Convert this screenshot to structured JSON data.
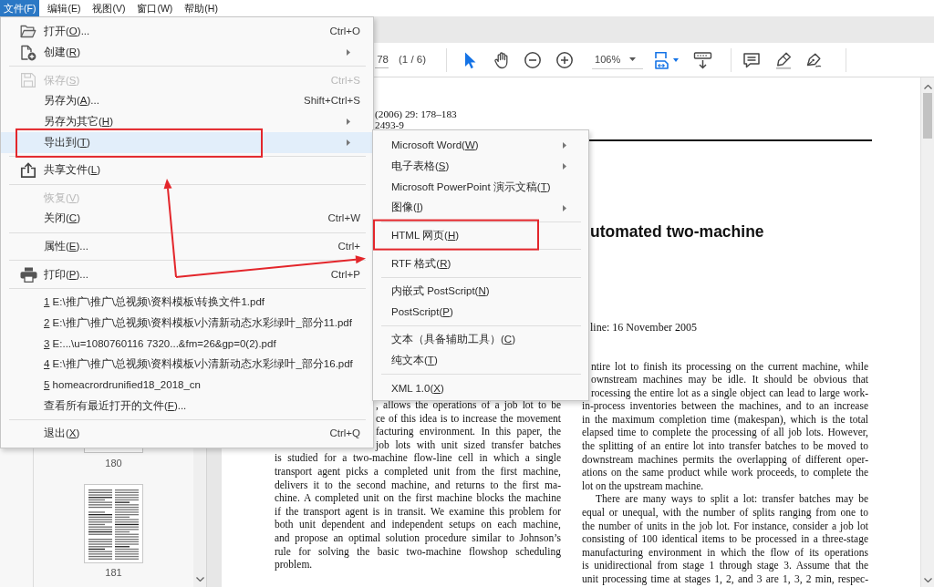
{
  "menu_bar": [
    {
      "label": "文件(F)",
      "selected": true
    },
    {
      "label": "编辑(E)",
      "selected": false
    },
    {
      "label": "视图(V)",
      "selected": false
    },
    {
      "label": "窗口(W)",
      "selected": false
    },
    {
      "label": "帮助(H)",
      "selected": false
    }
  ],
  "toolbar": {
    "page_field": {
      "value": "78"
    },
    "page_count": "(1 / 6)",
    "tools": [
      {
        "selected": true
      },
      {
        "selected": false
      }
    ],
    "zoom_field": {
      "value": "106%"
    },
    "fit_button": {
      "active": true
    }
  },
  "thumbnail_panel": {
    "pages": [
      {
        "kind": "cut",
        "label": "180"
      },
      {
        "kind": "full",
        "label": "181"
      }
    ]
  },
  "document": {
    "header_lines": [
      "(2006) 29: 178–183",
      "2493-9"
    ],
    "title": "utomated two-machine",
    "date_line": "line: 16 November 2005",
    "columns": [
      {
        "paragraphs": [
          {
            "kind": "cut",
            "lines": [
              ", allows the operations of a job lot to be",
              "ce of this idea is to increase the movement",
              "facturing environment. In this paper, the",
              "job lots with unit sized transfer batches"
            ]
          },
          {
            "kind": "full",
            "indent": false,
            "lines": [
              "is studied for a two-machine flow-line cell in which a single",
              "transport agent picks a completed unit from the first machine,",
              "delivers it to the second machine, and returns to the first ma-",
              "chine. A completed unit on the first machine blocks the machine",
              "if the transport agent is in transit. We examine this problem for",
              "both unit dependent and independent setups on each machine,",
              "and propose an optimal solution procedure similar to Johnson’s",
              "rule for solving the basic two-machine flowshop scheduling",
              "problem."
            ]
          }
        ]
      },
      {
        "paragraphs": [
          {
            "kind": "cut",
            "lines": [
              "ntire lot to finish its processing on the current machine, while",
              "ownstream machines may be idle. It should be obvious that",
              "rocessing the entire lot as a single object can lead to large work-"
            ]
          },
          {
            "kind": "full",
            "indent": false,
            "ends": true,
            "lines": [
              "in-process inventories between the machines, and to an increase",
              "in the maximum completion time (makespan), which is the total",
              "elapsed time to complete the processing of all job lots. However,",
              "the splitting of an entire lot into transfer batches to be moved to",
              "downstream machines permits the overlapping of different oper-",
              "ations on the same product while work proceeds, to complete the",
              "lot on the upstream machine."
            ]
          },
          {
            "kind": "full",
            "indent": true,
            "ends": false,
            "lines": [
              "There are many ways to split a lot: transfer batches may be",
              "equal or unequal, with the number of splits ranging from one to",
              "the number of units in the job lot. For instance, consider a job lot",
              "consisting of 100 identical items to be processed in a three-stage",
              "manufacturing environment in which the flow of its operations",
              "is unidirectional from stage 1 through stage 3. Assume that the",
              "unit processing time at stages 1, 2, and 3 are 1, 3, 2 min, respec-"
            ]
          }
        ]
      }
    ]
  },
  "file_menu": {
    "sections": [
      [
        {
          "before": "打开(",
          "access_key": "O",
          "after": ")...",
          "shortcut": "Ctrl+O",
          "has_submenu": false,
          "disabled": false,
          "highlighted": false,
          "marked": false
        },
        {
          "before": "创建(",
          "access_key": "R",
          "after": ")",
          "has_submenu": true,
          "disabled": false,
          "highlighted": false,
          "marked": false
        }
      ],
      [
        {
          "before": "保存(",
          "access_key": "S",
          "after": ")",
          "shortcut": "Ctrl+S",
          "has_submenu": false,
          "disabled": true,
          "highlighted": false,
          "marked": false
        },
        {
          "before": "另存为(",
          "access_key": "A",
          "after": ")...",
          "shortcut": "Shift+Ctrl+S",
          "has_submenu": false,
          "disabled": false,
          "highlighted": false,
          "marked": false
        },
        {
          "before": "另存为其它(",
          "access_key": "H",
          "after": ")",
          "has_submenu": true,
          "disabled": false,
          "highlighted": false,
          "marked": false
        },
        {
          "before": "导出到(",
          "access_key": "T",
          "after": ")",
          "has_submenu": true,
          "disabled": false,
          "highlighted": true,
          "marked": true
        }
      ],
      [
        {
          "before": "共享文件(",
          "access_key": "L",
          "after": ")",
          "has_submenu": false,
          "disabled": false,
          "highlighted": false,
          "marked": false
        }
      ],
      [
        {
          "before": "恢复(",
          "access_key": "V",
          "after": ")",
          "has_submenu": false,
          "disabled": true,
          "highlighted": false,
          "marked": false
        },
        {
          "before": "关闭(",
          "access_key": "C",
          "after": ")",
          "shortcut": "Ctrl+W",
          "has_submenu": false,
          "disabled": false,
          "highlighted": false,
          "marked": false
        }
      ],
      [
        {
          "before": "属性(",
          "access_key": "E",
          "after": ")...",
          "shortcut": "Ctrl+",
          "has_submenu": false,
          "disabled": false,
          "highlighted": false,
          "marked": false
        }
      ],
      [
        {
          "before": "打印(",
          "access_key": "P",
          "after": ")...",
          "shortcut": "Ctrl+P",
          "has_submenu": false,
          "disabled": false,
          "highlighted": false,
          "marked": false
        }
      ],
      [
        {
          "access_key": "1",
          "after": " E:\\推广\\推广\\总视频\\资料模板\\转换文件1.pdf",
          "has_submenu": false,
          "disabled": false,
          "highlighted": false,
          "marked": false
        },
        {
          "access_key": "2",
          "after": " E:\\推广\\推广\\总视频\\资料模板\\小清新动态水彩绿叶_部分11.pdf",
          "has_submenu": false,
          "disabled": false,
          "highlighted": false,
          "marked": false
        },
        {
          "access_key": "3",
          "after": " E:...\\u=1080760116 7320...&fm=26&gp=0(2).pdf",
          "has_submenu": false,
          "disabled": false,
          "highlighted": false,
          "marked": false
        },
        {
          "access_key": "4",
          "after": " E:\\推广\\推广\\总视频\\资料模板\\小清新动态水彩绿叶_部分16.pdf",
          "has_submenu": false,
          "disabled": false,
          "highlighted": false,
          "marked": false
        },
        {
          "access_key": "5",
          "after": " homeacrordrunified18_2018_cn",
          "has_submenu": false,
          "disabled": false,
          "highlighted": false,
          "marked": false
        },
        {
          "before": "查看所有最近打开的文件(",
          "access_key": "F",
          "after": ")...",
          "has_submenu": false,
          "disabled": false,
          "highlighted": false,
          "marked": false
        }
      ],
      [
        {
          "before": "退出(",
          "access_key": "X",
          "after": ")",
          "shortcut": "Ctrl+Q",
          "has_submenu": false,
          "disabled": false,
          "highlighted": false,
          "marked": false
        }
      ]
    ]
  },
  "export_submenu": {
    "sections": [
      [
        {
          "before": "Microsoft Word(",
          "access_key": "W",
          "after": ")",
          "has_submenu": true,
          "disabled": false,
          "highlighted": false,
          "marked": false
        },
        {
          "before": "电子表格(",
          "access_key": "S",
          "after": ")",
          "has_submenu": true,
          "disabled": false,
          "highlighted": false,
          "marked": false
        },
        {
          "before": "Microsoft PowerPoint 演示文稿(",
          "access_key": "T",
          "after": ")",
          "has_submenu": false,
          "disabled": false,
          "highlighted": false,
          "marked": false
        },
        {
          "before": "图像(",
          "access_key": "I",
          "after": ")",
          "has_submenu": true,
          "disabled": false,
          "highlighted": false,
          "marked": false
        }
      ],
      [
        {
          "before": "HTML 网页(",
          "access_key": "H",
          "after": ")",
          "has_submenu": false,
          "disabled": false,
          "highlighted": false,
          "marked": true
        }
      ],
      [
        {
          "before": "RTF 格式(",
          "access_key": "R",
          "after": ")",
          "has_submenu": false,
          "disabled": false,
          "highlighted": false,
          "marked": false
        }
      ],
      [
        {
          "before": "内嵌式 PostScript(",
          "access_key": "N",
          "after": ")",
          "has_submenu": false,
          "disabled": false,
          "highlighted": false,
          "marked": false
        },
        {
          "before": "PostScript(",
          "access_key": "P",
          "after": ")",
          "has_submenu": false,
          "disabled": false,
          "highlighted": false,
          "marked": false
        }
      ],
      [
        {
          "before": "文本（具备辅助工具）(",
          "access_key": "C",
          "after": ")",
          "has_submenu": false,
          "disabled": false,
          "highlighted": false,
          "marked": false
        },
        {
          "before": "纯文本(",
          "access_key": "T",
          "after": ")",
          "has_submenu": false,
          "disabled": false,
          "highlighted": false,
          "marked": false
        }
      ],
      [
        {
          "before": "XML 1.0(",
          "access_key": "X",
          "after": ")",
          "has_submenu": false,
          "disabled": false,
          "highlighted": false,
          "marked": false
        }
      ]
    ]
  },
  "annotation_arrows": true
}
